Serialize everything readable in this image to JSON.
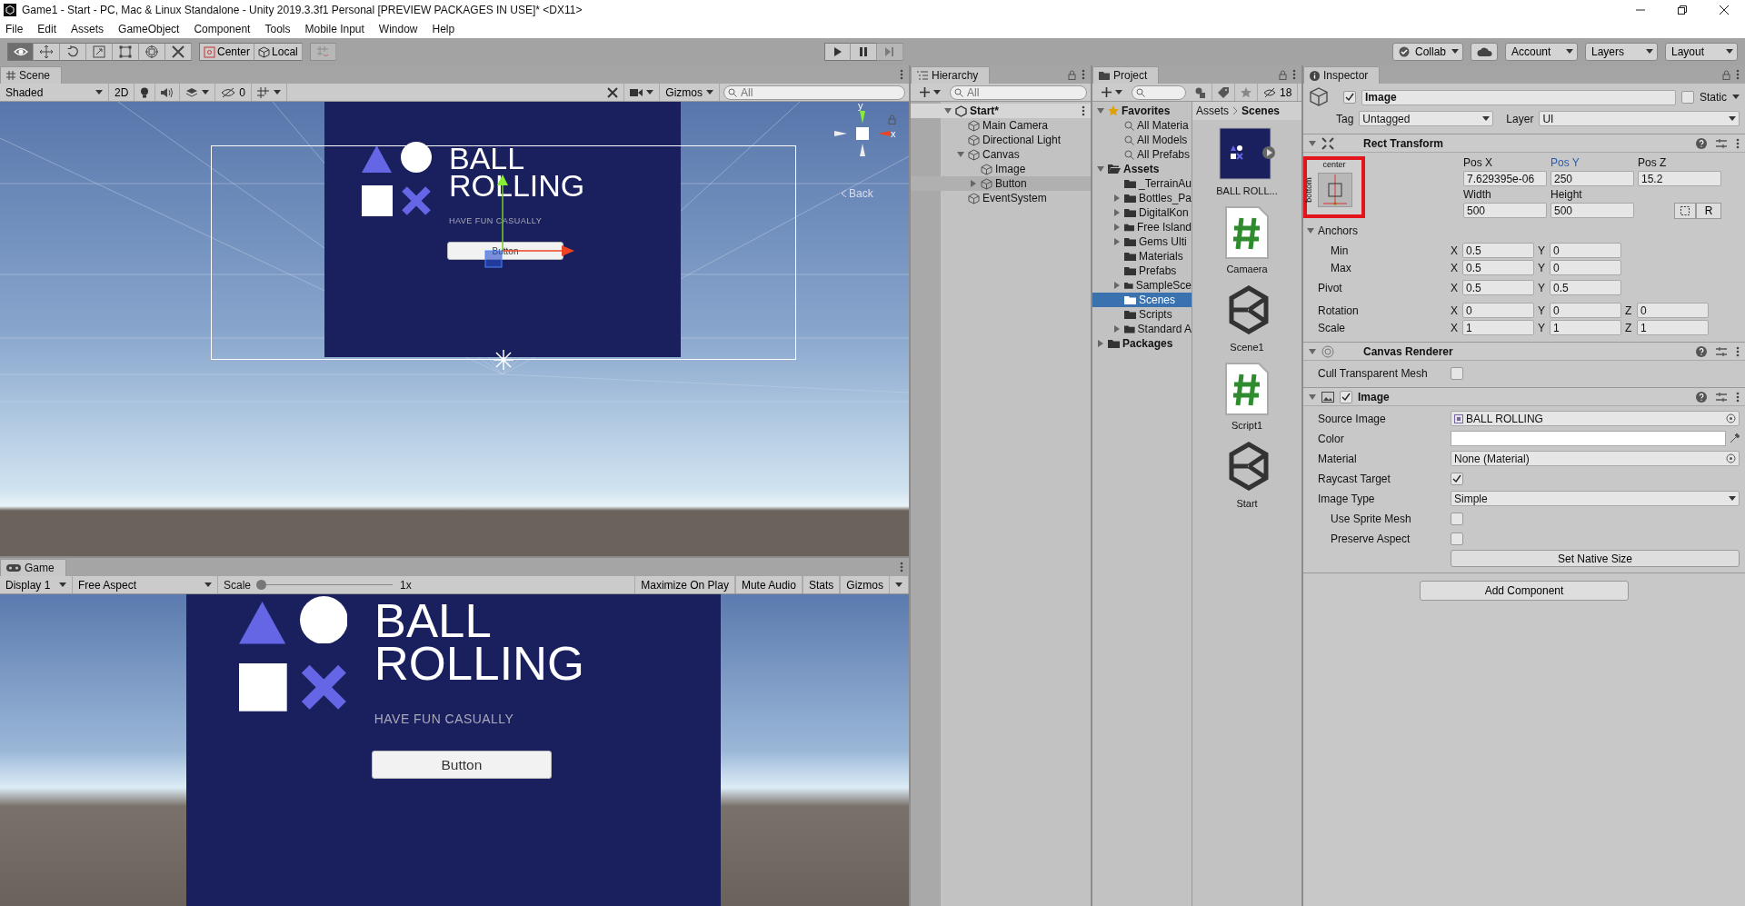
{
  "window": {
    "title": "Game1 - Start - PC, Mac & Linux Standalone - Unity 2019.3.3f1 Personal [PREVIEW PACKAGES IN USE]* <DX11>"
  },
  "menu": [
    "File",
    "Edit",
    "Assets",
    "GameObject",
    "Component",
    "Tools",
    "Mobile Input",
    "Window",
    "Help"
  ],
  "toolbar": {
    "tools": [
      {
        "kind": "view",
        "selected": true
      },
      {
        "kind": "move",
        "selected": false
      },
      {
        "kind": "rotate",
        "selected": false
      },
      {
        "kind": "scale",
        "selected": false
      },
      {
        "kind": "rect",
        "selected": false
      },
      {
        "kind": "transform",
        "selected": false
      },
      {
        "kind": "custom",
        "selected": false
      }
    ],
    "pivot_mode": "Center",
    "pivot_space": "Local",
    "collab": "Collab",
    "account": "Account",
    "layers": "Layers",
    "layout": "Layout"
  },
  "scene": {
    "tab": "Scene",
    "draw_mode": "Shaded",
    "toggle_2d": "2D",
    "hidden_count": "0",
    "gizmos": "Gizmos",
    "search": {
      "placeholder": "All"
    },
    "orientation": {
      "y": "y",
      "x": "x",
      "back": "Back"
    },
    "preview": {
      "title_lines": [
        "BALL",
        "ROLLING"
      ],
      "tagline": "HAVE FUN CASUALLY",
      "button": "Button"
    }
  },
  "game": {
    "tab": "Game",
    "display": "Display 1",
    "aspect": "Free Aspect",
    "scale_label": "Scale",
    "scale": {
      "level": 0
    },
    "scale_value": "1x",
    "options": [
      "Maximize On Play",
      "Mute Audio",
      "Stats",
      "Gizmos"
    ],
    "preview": {
      "title_lines": [
        "BALL",
        "ROLLING"
      ],
      "tagline": "HAVE FUN CASUALLY",
      "button": "Button"
    }
  },
  "hierarchy": {
    "tab": "Hierarchy",
    "search": {
      "placeholder": "All"
    },
    "tree": [
      {
        "label": "Start*",
        "kind": "scene",
        "expanded": true,
        "selected": false,
        "children": [
          {
            "label": "Main Camera",
            "kind": "object",
            "selected": false
          },
          {
            "label": "Directional Light",
            "kind": "object",
            "selected": false
          },
          {
            "label": "Canvas",
            "kind": "object",
            "expanded": true,
            "selected": false,
            "children": [
              {
                "label": "Image",
                "kind": "object",
                "selected": false
              },
              {
                "label": "Button",
                "kind": "object",
                "expanded": false,
                "selected": true
              }
            ]
          },
          {
            "label": "EventSystem",
            "kind": "object",
            "selected": false
          }
        ]
      }
    ]
  },
  "project": {
    "tab": "Project",
    "hidden_count": "18",
    "tree": [
      {
        "label": "Favorites",
        "kind": "favorites",
        "expanded": true,
        "selected": false,
        "children": [
          {
            "label": "All Materia",
            "kind": "search",
            "selected": false
          },
          {
            "label": "All Models",
            "kind": "search",
            "selected": false
          },
          {
            "label": "All Prefabs",
            "kind": "search",
            "selected": false
          }
        ]
      },
      {
        "label": "Assets",
        "kind": "folder-open",
        "expanded": true,
        "selected": false,
        "children": [
          {
            "label": "_TerrainAu",
            "kind": "folder",
            "selected": false
          },
          {
            "label": "Bottles_Pa",
            "kind": "folder",
            "expanded": false,
            "selected": false
          },
          {
            "label": "DigitalKon",
            "kind": "folder",
            "expanded": false,
            "selected": false
          },
          {
            "label": "Free Island",
            "kind": "folder",
            "expanded": false,
            "selected": false
          },
          {
            "label": "Gems Ulti",
            "kind": "folder",
            "expanded": false,
            "selected": false
          },
          {
            "label": "Materials",
            "kind": "folder",
            "selected": false
          },
          {
            "label": "Prefabs",
            "kind": "folder",
            "selected": false
          },
          {
            "label": "SampleSce",
            "kind": "folder",
            "expanded": false,
            "selected": false
          },
          {
            "label": "Scenes",
            "kind": "folder",
            "selected": true
          },
          {
            "label": "Scripts",
            "kind": "folder",
            "selected": false
          },
          {
            "label": "Standard A",
            "kind": "folder",
            "expanded": false,
            "selected": false
          }
        ]
      },
      {
        "label": "Packages",
        "kind": "folder",
        "expanded": false,
        "selected": false
      }
    ],
    "breadcrumb": [
      "Assets",
      "Scenes"
    ],
    "assets": [
      {
        "label": "BALL ROLL...",
        "kind": "sprite"
      },
      {
        "label": "Camaera",
        "kind": "script"
      },
      {
        "label": "Scene1",
        "kind": "scene"
      },
      {
        "label": "Script1",
        "kind": "script"
      },
      {
        "label": "Start",
        "kind": "scene"
      }
    ]
  },
  "inspector": {
    "tab": "Inspector",
    "object": {
      "active": true,
      "name": "Image",
      "static_label": "Static",
      "static": false,
      "tag_label": "Tag",
      "tag": "Untagged",
      "layer_label": "Layer",
      "layer": "UI"
    },
    "components": [
      {
        "kind": "rect_transform",
        "title": "Rect Transform",
        "expanded": true,
        "anchor_preset": {
          "horizontal": "center",
          "vertical": "bottom",
          "highlighted": true
        },
        "position": [
          {
            "label": "Pos X",
            "value": "7.629395e-06",
            "highlighted": false
          },
          {
            "label": "Pos Y",
            "value": "250",
            "highlighted": true
          },
          {
            "label": "Pos Z",
            "value": "15.2",
            "highlighted": false
          }
        ],
        "size": [
          {
            "label": "Width",
            "value": "500"
          },
          {
            "label": "Height",
            "value": "500"
          }
        ],
        "raw_button": "R",
        "anchors": {
          "label": "Anchors",
          "expanded": true,
          "rows": [
            {
              "label": "Min",
              "fields": [
                {
                  "axis": "X",
                  "value": "0.5"
                },
                {
                  "axis": "Y",
                  "value": "0"
                }
              ]
            },
            {
              "label": "Max",
              "fields": [
                {
                  "axis": "X",
                  "value": "0.5"
                },
                {
                  "axis": "Y",
                  "value": "0"
                }
              ]
            }
          ]
        },
        "vectors": [
          {
            "label": "Pivot",
            "fields": [
              {
                "axis": "X",
                "value": "0.5"
              },
              {
                "axis": "Y",
                "value": "0.5"
              }
            ]
          },
          {
            "label": "Rotation",
            "fields": [
              {
                "axis": "X",
                "value": "0"
              },
              {
                "axis": "Y",
                "value": "0"
              },
              {
                "axis": "Z",
                "value": "0"
              }
            ]
          },
          {
            "label": "Scale",
            "fields": [
              {
                "axis": "X",
                "value": "1"
              },
              {
                "axis": "Y",
                "value": "1"
              },
              {
                "axis": "Z",
                "value": "1"
              }
            ]
          }
        ]
      },
      {
        "kind": "canvas_renderer",
        "title": "Canvas Renderer",
        "expanded": true,
        "properties": [
          {
            "kind": "checkbox",
            "label": "Cull Transparent Mesh",
            "checked": false,
            "indented": false
          }
        ]
      },
      {
        "kind": "image",
        "title": "Image",
        "enabled": true,
        "expanded": true,
        "properties": [
          {
            "kind": "sprite",
            "label": "Source Image",
            "value": "BALL ROLLING",
            "indented": false
          },
          {
            "kind": "color",
            "label": "Color",
            "color": "#ffffff",
            "indented": false
          },
          {
            "kind": "object",
            "label": "Material",
            "value": "None (Material)",
            "indented": false
          },
          {
            "kind": "checkbox",
            "label": "Raycast Target",
            "checked": true,
            "indented": false
          },
          {
            "kind": "dropdown",
            "label": "Image Type",
            "value": "Simple",
            "indented": false
          },
          {
            "kind": "checkbox",
            "label": "Use Sprite Mesh",
            "checked": false,
            "indented": true
          },
          {
            "kind": "checkbox",
            "label": "Preserve Aspect",
            "checked": false,
            "indented": true
          },
          {
            "kind": "button",
            "label": "Set Native Size"
          }
        ]
      }
    ],
    "add_component": "Add Component"
  }
}
